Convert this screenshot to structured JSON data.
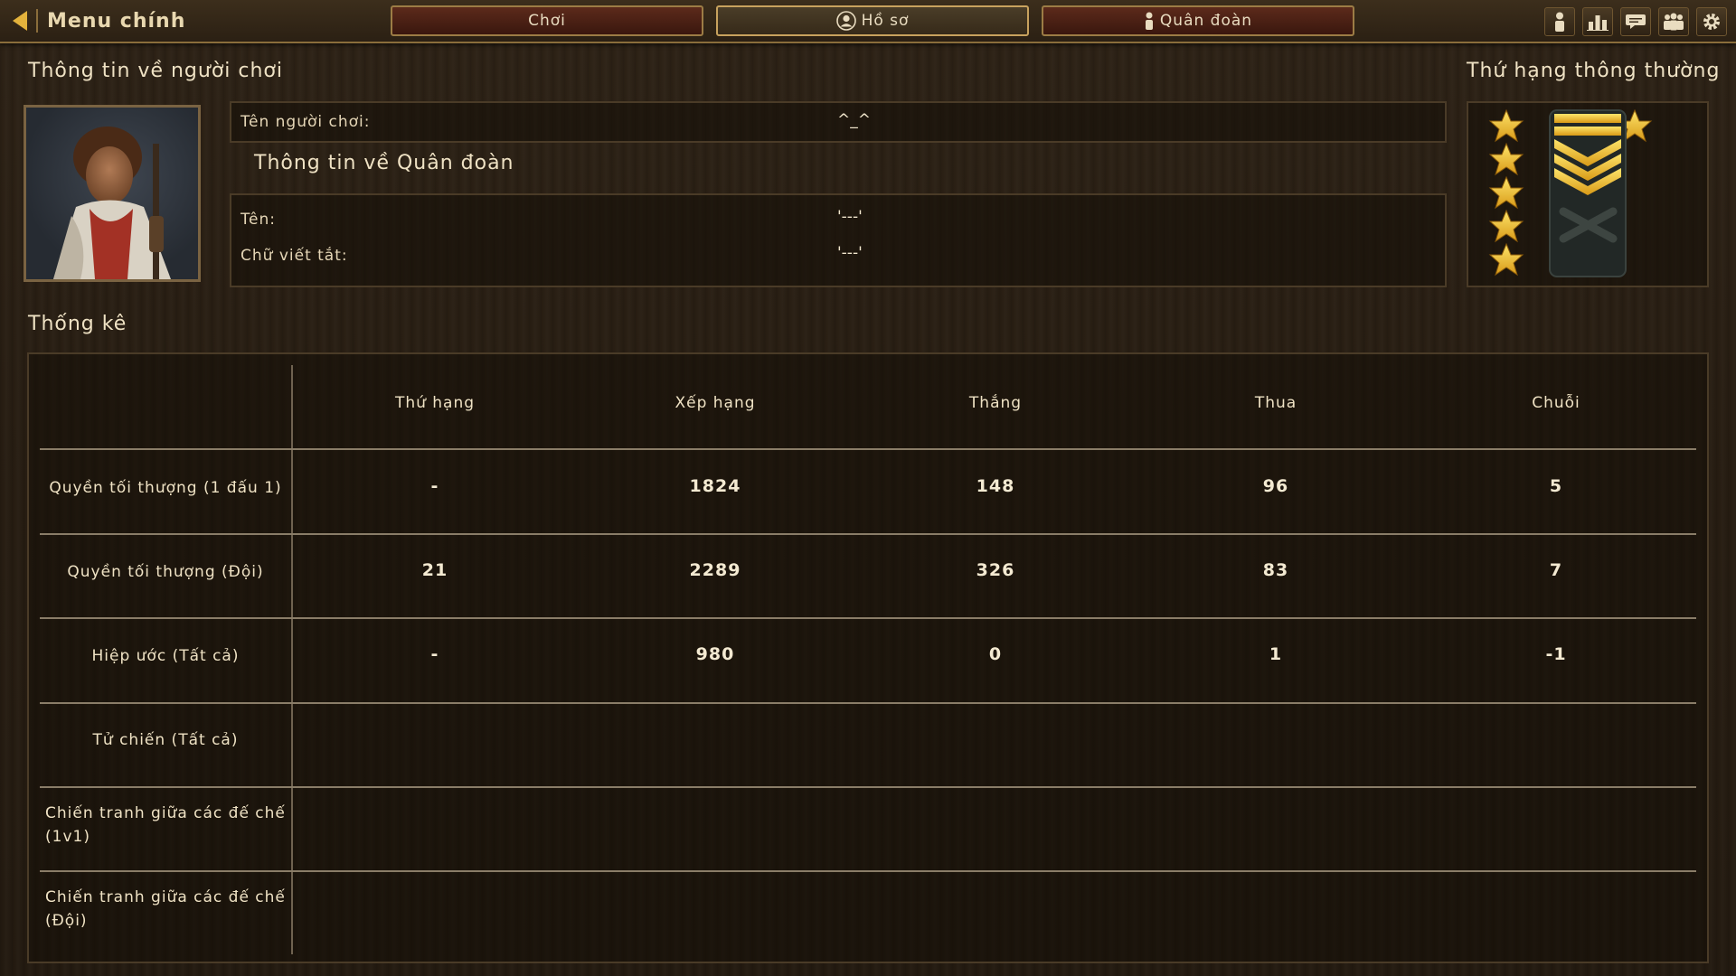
{
  "topbar": {
    "back_label": "Menu chính",
    "tabs": {
      "play": "Chơi",
      "profile": "Hồ sơ",
      "corps": "Quân đoàn"
    }
  },
  "player_info": {
    "title": "Thông tin về người chơi",
    "name_label": "Tên người chơi:",
    "name_value": "^_^"
  },
  "corps_info": {
    "title": "Thông tin về Quân đoàn",
    "name_label": "Tên:",
    "name_value": "'---'",
    "abbr_label": "Chữ viết tắt:",
    "abbr_value": "'---'"
  },
  "rank": {
    "title": "Thứ hạng thông thường"
  },
  "stats": {
    "title": "Thống kê",
    "columns": [
      "Thứ hạng",
      "Xếp hạng",
      "Thắng",
      "Thua",
      "Chuỗi"
    ],
    "rows": [
      {
        "label": "Quyền tối thượng (1 đấu 1)",
        "values": [
          "-",
          "1824",
          "148",
          "96",
          "5"
        ]
      },
      {
        "label": "Quyền tối thượng (Đội)",
        "values": [
          "21",
          "2289",
          "326",
          "83",
          "7"
        ]
      },
      {
        "label": "Hiệp ước (Tất cả)",
        "values": [
          "-",
          "980",
          "0",
          "1",
          "-1"
        ]
      },
      {
        "label": "Tử chiến (Tất cả)",
        "values": [
          "",
          "",
          "",
          "",
          ""
        ]
      },
      {
        "label": "Chiến tranh giữa các đế chế (1v1)",
        "values": [
          "",
          "",
          "",
          "",
          ""
        ]
      },
      {
        "label": "Chiến tranh giữa các đế chế (Đội)",
        "values": [
          "",
          "",
          "",
          "",
          ""
        ]
      }
    ]
  },
  "colors": {
    "accent_gold": "#e3b23c",
    "star_gold": "#f2c230",
    "tab_red": "#5c2a1b"
  },
  "icons": [
    "back-arrow-icon",
    "user-icon",
    "leaderboard-icon",
    "chat-icon",
    "group-icon",
    "settings-icon",
    "star-icon",
    "chevron-rank-icon"
  ]
}
